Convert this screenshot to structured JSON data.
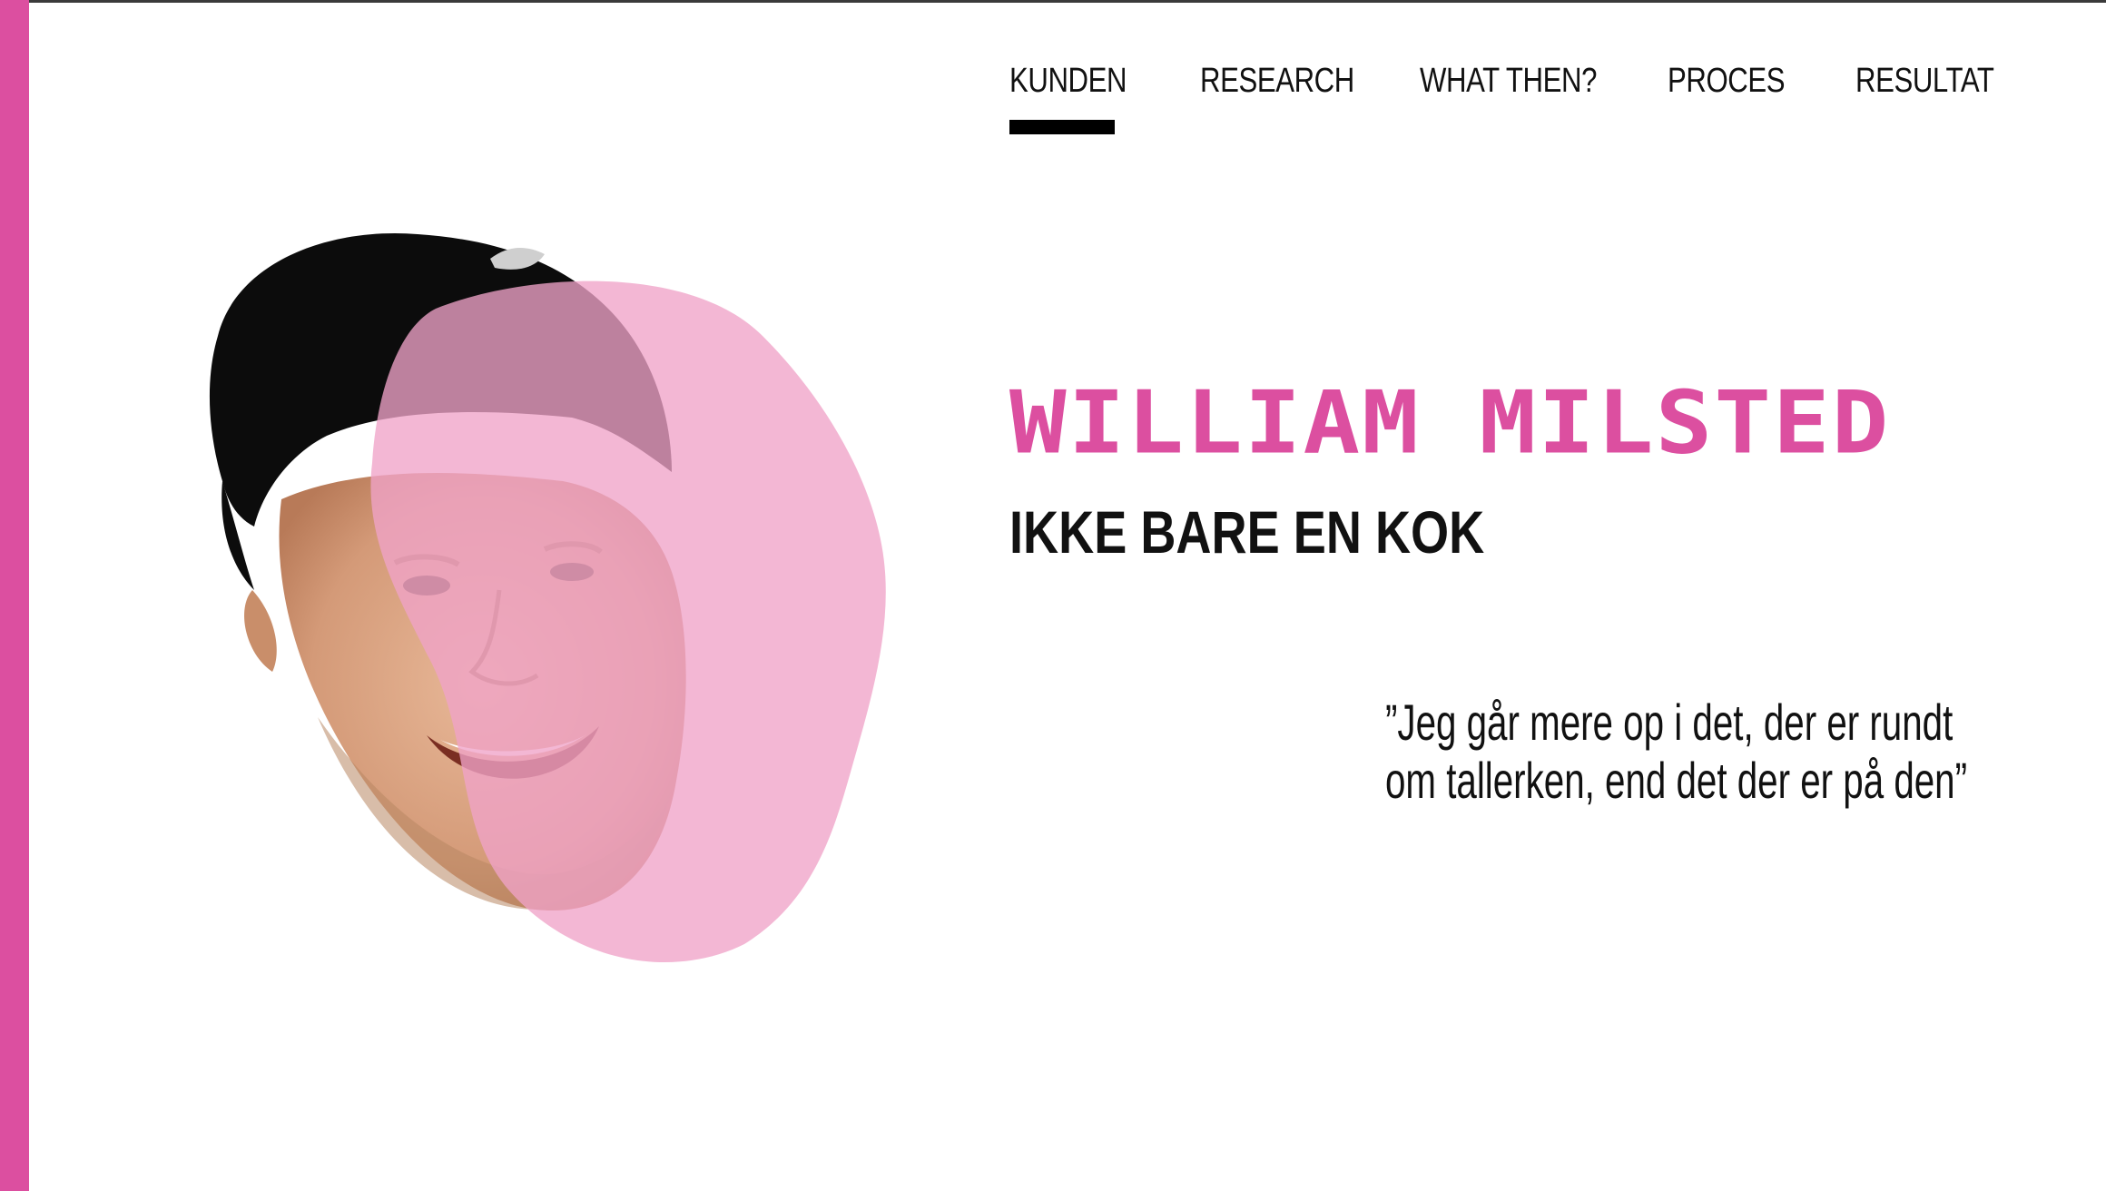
{
  "nav": {
    "items": [
      {
        "label": "KUNDEN",
        "active": true
      },
      {
        "label": "RESEARCH",
        "active": false
      },
      {
        "label": "WHAT THEN?",
        "active": false
      },
      {
        "label": "PROCES",
        "active": false
      },
      {
        "label": "RESULTAT",
        "active": false
      }
    ]
  },
  "hero": {
    "name": "WILLIAM MILSTED",
    "subtitle": "IKKE BARE EN KOK",
    "quote_line_1": "”Jeg går mere op i det, der er rundt",
    "quote_line_2": "om tallerken, end det der er på den”"
  },
  "colors": {
    "accent": "#dc4fa0",
    "blob": "#f0a3c8",
    "text": "#111111"
  },
  "icons": {
    "portrait": "person-portrait-photo"
  }
}
